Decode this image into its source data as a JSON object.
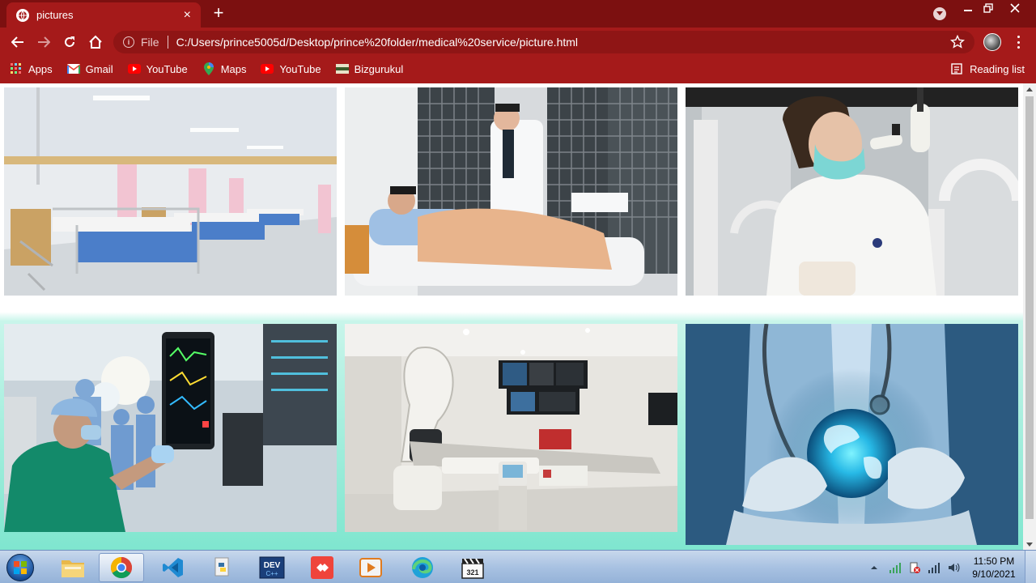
{
  "browser": {
    "tab_title": "pictures",
    "tab_close": "×",
    "new_tab": "+",
    "url_scheme": "File",
    "url": "C:/Users/prince5005d/Desktop/prince%20folder/medical%20service/picture.html",
    "colors": {
      "tabstrip": "#7c1010",
      "toolbar": "#a51a1a"
    },
    "window_controls": {
      "minimize": "–",
      "maximize": "❐",
      "close": "✕"
    }
  },
  "bookmarks": {
    "items": [
      {
        "label": "Apps",
        "icon": "apps-grid-icon"
      },
      {
        "label": "Gmail",
        "icon": "gmail-icon"
      },
      {
        "label": "YouTube",
        "icon": "youtube-icon"
      },
      {
        "label": "Maps",
        "icon": "maps-icon"
      },
      {
        "label": "YouTube",
        "icon": "youtube-icon"
      },
      {
        "label": "Bizgurukul",
        "icon": "bizgurukul-icon"
      }
    ],
    "reading_list": "Reading list"
  },
  "gallery": {
    "photos": [
      {
        "name": "hospital-ward-photo",
        "subject": "hospital ward beds"
      },
      {
        "name": "doctor-patient-photo",
        "subject": "doctor with patient in bed"
      },
      {
        "name": "lab-scientist-photo",
        "subject": "lab scientist with sample"
      },
      {
        "name": "surgery-room-photo",
        "subject": "surgical team with monitors"
      },
      {
        "name": "imaging-room-photo",
        "subject": "angiography imaging room"
      },
      {
        "name": "global-health-photo",
        "subject": "doctor holding glowing globe"
      }
    ],
    "background_gradient": [
      "#ffffff",
      "#7fe6cf"
    ]
  },
  "taskbar": {
    "apps": [
      {
        "name": "file-explorer",
        "icon": "folder-icon"
      },
      {
        "name": "chrome",
        "icon": "chrome-icon",
        "active": true
      },
      {
        "name": "vscode",
        "icon": "vscode-icon"
      },
      {
        "name": "python",
        "icon": "python-icon"
      },
      {
        "name": "devcpp",
        "icon": "devcpp-icon",
        "label": "DEV"
      },
      {
        "name": "anydesk",
        "icon": "anydesk-icon"
      },
      {
        "name": "media-player",
        "icon": "media-player-icon"
      },
      {
        "name": "edge",
        "icon": "edge-icon"
      },
      {
        "name": "media-player-classic",
        "icon": "clapper-icon",
        "label": "321"
      }
    ],
    "clock_time": "11:50 PM",
    "clock_date": "9/10/2021"
  }
}
